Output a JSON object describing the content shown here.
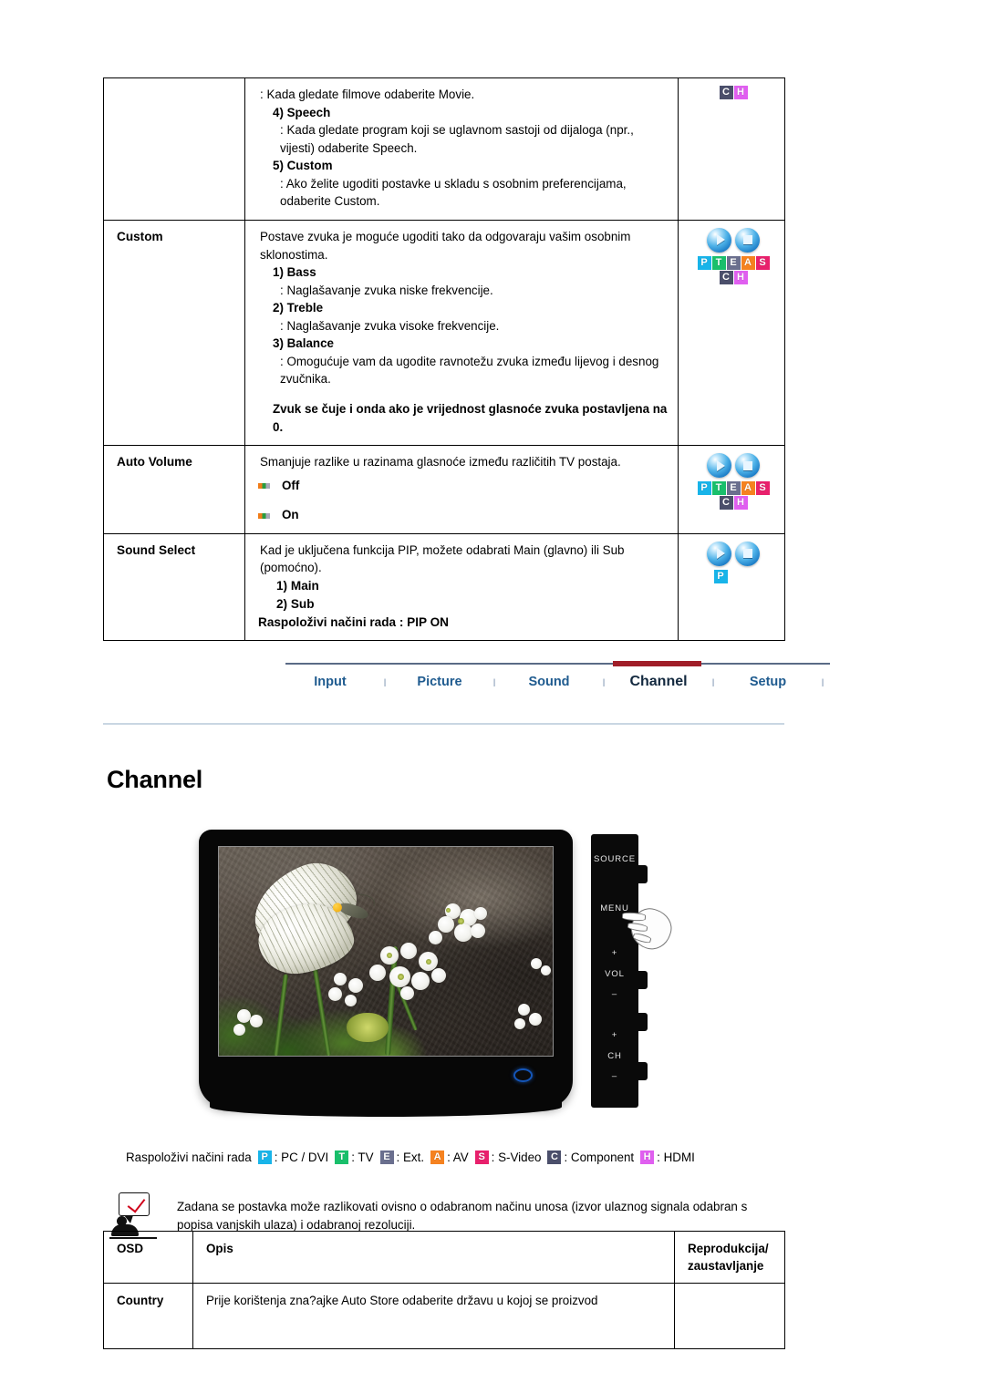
{
  "top_table": {
    "rows": [
      {
        "label": "",
        "blocks": [
          {
            "kind": "plain",
            "text": ": Kada gledate filmove odaberite Movie."
          },
          {
            "kind": "subhead",
            "text": "4) Speech"
          },
          {
            "kind": "subbody",
            "text": ": Kada gledate program koji se uglavnom sastoji od dijaloga (npr., vijesti) odaberite Speech."
          },
          {
            "kind": "subhead",
            "text": "5) Custom"
          },
          {
            "kind": "subbody",
            "text": ": Ako želite ugoditi postavke u skladu s osobnim preferencijama, odaberite Custom."
          }
        ],
        "icon": "ch-badge"
      },
      {
        "label": "Custom",
        "blocks": [
          {
            "kind": "plain",
            "text": "Postave zvuka je moguće ugoditi tako da odgovaraju vašim osobnim sklonostima."
          },
          {
            "kind": "subhead",
            "text": "1) Bass"
          },
          {
            "kind": "subbody",
            "text": ": Naglašavanje zvuka niske frekvencije."
          },
          {
            "kind": "subhead",
            "text": "2) Treble"
          },
          {
            "kind": "subbody",
            "text": ": Naglašavanje zvuka visoke frekvencije."
          },
          {
            "kind": "subhead",
            "text": "3) Balance"
          },
          {
            "kind": "subbody",
            "text": ": Omogućuje vam da ugodite ravnotežu zvuka između lijevog i desnog zvučnika."
          },
          {
            "kind": "spacer",
            "text": ""
          },
          {
            "kind": "notebold",
            "text": "Zvuk se čuje i onda ako je vrijednost glasnoće zvuka postavljena na 0."
          }
        ],
        "icon": "orbs-pteas-ch"
      },
      {
        "label": "Auto Volume",
        "blocks": [
          {
            "kind": "plain",
            "text": "Smanjuje razlike u razinama glasnoće između različitih TV postaja."
          },
          {
            "kind": "option",
            "text": "Off"
          },
          {
            "kind": "option",
            "text": "On"
          }
        ],
        "icon": "orbs-pteas-ch"
      },
      {
        "label": "Sound Select",
        "blocks": [
          {
            "kind": "plain",
            "text": "Kad je uključena funkcija PIP, možete odabrati Main (glavno) ili Sub (pomoćno)."
          },
          {
            "kind": "indent2",
            "text": "1) Main"
          },
          {
            "kind": "indent2",
            "text": "2) Sub"
          },
          {
            "kind": "notebold0",
            "text": "Raspoloživi načini rada : PIP ON"
          }
        ],
        "icon": "orbs-p"
      }
    ]
  },
  "nav": {
    "separator": "I",
    "items": [
      {
        "label": "Input",
        "active": false
      },
      {
        "label": "Picture",
        "active": false
      },
      {
        "label": "Sound",
        "active": false
      },
      {
        "label": "Channel",
        "active": true
      },
      {
        "label": "Setup",
        "active": false
      }
    ],
    "active_color": "#a01e28",
    "link_color": "#1f5b8f"
  },
  "page": {
    "heading": "Channel"
  },
  "monitor": {
    "buttons": [
      "SOURCE",
      "MENU",
      "+",
      "VOL",
      "–",
      "+",
      "CH",
      "–"
    ],
    "screen_alt": "butterfly-on-white-flowers"
  },
  "legend": {
    "prefix": "Raspoloživi načini rada",
    "entries": [
      {
        "letter": "P",
        "color": "#18b4e9",
        "text": ": PC / DVI"
      },
      {
        "letter": "T",
        "color": "#19bf6b",
        "text": ": TV"
      },
      {
        "letter": "E",
        "color": "#6a6f8e",
        "text": ": Ext."
      },
      {
        "letter": "A",
        "color": "#f58220",
        "text": ": AV"
      },
      {
        "letter": "S",
        "color": "#e8206c",
        "text": ": S-Video"
      },
      {
        "letter": "C",
        "color": "#4b4f6b",
        "text": ": Component"
      },
      {
        "letter": "H",
        "color": "#e05ff0",
        "text": ": HDMI"
      }
    ]
  },
  "note": {
    "text": "Zadana se postavka može razlikovati ovisno o odabranom načinu unosa (izvor ulaznog signala odabran s popisa vanjskih ulaza) i odabranoj rezoluciji."
  },
  "bottom_table": {
    "headers": {
      "osd": "OSD",
      "opis": "Opis",
      "repro_line1": "Reprodukcija/",
      "repro_line2": "zaustavljanje"
    },
    "rows": [
      {
        "osd": "Country",
        "opis": "Prije korištenja zna?ajke Auto Store odaberite državu u kojoj se proizvod",
        "repro": ""
      }
    ]
  }
}
